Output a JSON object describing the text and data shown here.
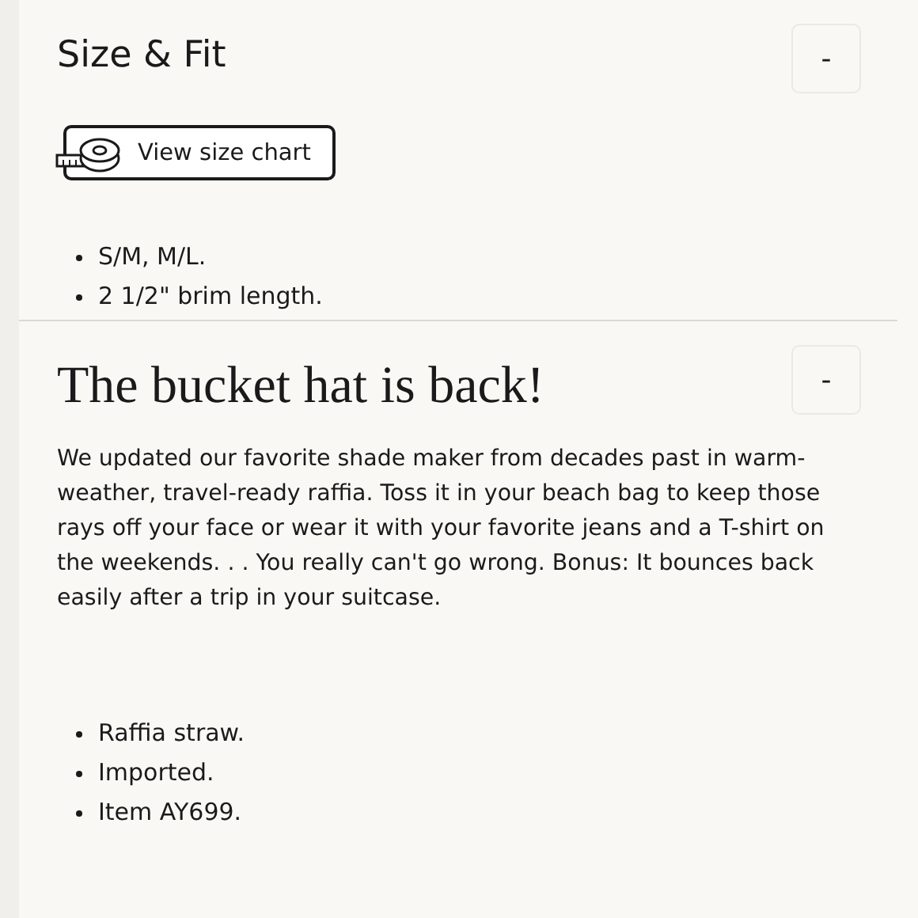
{
  "sections": [
    {
      "kind": "sizing",
      "title": "Size & Fit",
      "toggle": "-",
      "size_chart_button": "View size chart",
      "bullets": [
        "S/M, M/L.",
        "2 1/2\" brim length."
      ]
    },
    {
      "kind": "story",
      "title": "The bucket hat is back!",
      "toggle": "-",
      "paragraph": "We updated our favorite shade maker from decades past in warm-weather, travel-ready raffia. Toss it in your beach bag to keep those rays off your face or wear it with your favorite jeans and a T-shirt on the weekends. . . You really can't go wrong. Bonus: It bounces back easily after a trip in your suitcase.",
      "bullets": [
        "Raffia straw.",
        "Imported.",
        "Item AY699."
      ]
    }
  ]
}
